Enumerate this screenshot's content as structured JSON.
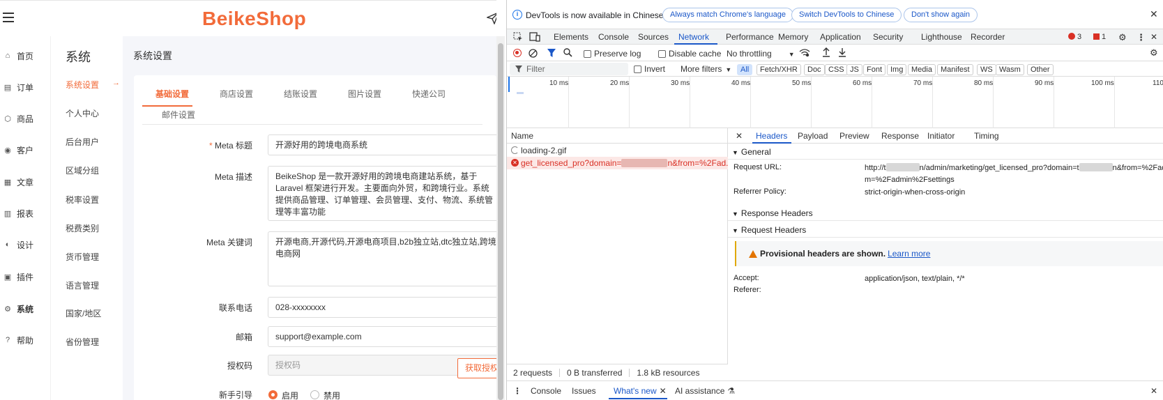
{
  "app": {
    "logo": "BeikeShop",
    "main_nav": [
      {
        "icon": "home-icon",
        "glyph": "⌂",
        "label": "首页"
      },
      {
        "icon": "order-icon",
        "glyph": "▤",
        "label": "订单"
      },
      {
        "icon": "product-icon",
        "glyph": "⬡",
        "label": "商品"
      },
      {
        "icon": "customer-icon",
        "glyph": "◉",
        "label": "客户"
      },
      {
        "icon": "article-icon",
        "glyph": "▦",
        "label": "文章"
      },
      {
        "icon": "report-icon",
        "glyph": "▥",
        "label": "报表"
      },
      {
        "icon": "design-icon",
        "glyph": "◐",
        "label": "设计"
      },
      {
        "icon": "plugin-icon",
        "glyph": "▣",
        "label": "插件"
      },
      {
        "icon": "system-icon",
        "glyph": "⚙",
        "label": "系统"
      },
      {
        "icon": "help-icon",
        "glyph": "?",
        "label": "帮助"
      }
    ],
    "sub_nav_title": "系统",
    "sub_nav": [
      "系统设置",
      "个人中心",
      "后台用户",
      "区域分组",
      "税率设置",
      "税费类别",
      "货币管理",
      "语言管理",
      "国家/地区",
      "省份管理"
    ],
    "page_title": "系统设置",
    "tabs": [
      "基础设置",
      "商店设置",
      "结账设置",
      "图片设置",
      "快递公司",
      "邮件设置"
    ],
    "form": {
      "meta_title_label": "Meta 标题",
      "meta_title_value": "开源好用的跨境电商系统",
      "meta_desc_label": "Meta 描述",
      "meta_desc_value": "BeikeShop 是一款开源好用的跨境电商建站系统，基于 Laravel 框架进行开发。主要面向外贸，和跨境行业。系统提供商品管理、订单管理、会员管理、支付、物流、系统管理等丰富功能",
      "meta_keywords_label": "Meta 关键词",
      "meta_keywords_value": "开源电商,开源代码,开源电商项目,b2b独立站,dtc独立站,跨境电商网",
      "phone_label": "联系电话",
      "phone_value": "028-xxxxxxxx",
      "email_label": "邮箱",
      "email_value": "support@example.com",
      "license_label": "授权码",
      "license_placeholder": "授权码",
      "license_button": "获取授权",
      "guide_label": "新手引导",
      "guide_on": "启用",
      "guide_off": "禁用"
    }
  },
  "devtools": {
    "info_text": "DevTools is now available in Chinese!",
    "info_buttons": [
      "Always match Chrome's language",
      "Switch DevTools to Chinese",
      "Don't show again"
    ],
    "tabs": [
      "Elements",
      "Console",
      "Sources",
      "Network",
      "Performance",
      "Memory",
      "Application",
      "Security",
      "Lighthouse",
      "Recorder"
    ],
    "error_count": "3",
    "issue_count": "1",
    "toolbar": {
      "preserve_log": "Preserve log",
      "disable_cache": "Disable cache",
      "throttling": "No throttling"
    },
    "filter_placeholder": "Filter",
    "invert": "Invert",
    "more_filters": "More filters",
    "type_filters": [
      "All",
      "Fetch/XHR",
      "Doc",
      "CSS",
      "JS",
      "Font",
      "Img",
      "Media",
      "Manifest",
      "WS",
      "Wasm",
      "Other"
    ],
    "timeline_labels": [
      "10 ms",
      "20 ms",
      "30 ms",
      "40 ms",
      "50 ms",
      "60 ms",
      "70 ms",
      "80 ms",
      "90 ms",
      "100 ms",
      "110"
    ],
    "list_header": "Name",
    "requests": [
      {
        "name": "loading-2.gif",
        "status": "pending"
      },
      {
        "name_prefix": "get_licensed_pro?domain=",
        "name_suffix": "n&from=%2Fad...",
        "status": "error"
      }
    ],
    "status_bar": {
      "requests": "2 requests",
      "transferred": "0 B transferred",
      "resources": "1.8 kB resources"
    },
    "detail_tabs": [
      "Headers",
      "Payload",
      "Preview",
      "Response",
      "Initiator",
      "Timing"
    ],
    "general_title": "General",
    "request_url_label": "Request URL:",
    "request_url_value_1a": "http://t",
    "request_url_value_1b": "n/admin/marketing/get_licensed_pro?domain=t",
    "request_url_value_1c": "n&from=%2Fad",
    "request_url_value_2": "m=%2Fadmin%2Fsettings",
    "referrer_policy_label": "Referrer Policy:",
    "referrer_policy_value": "strict-origin-when-cross-origin",
    "response_headers_title": "Response Headers",
    "request_headers_title": "Request Headers",
    "provisional_text": "Provisional headers are shown.",
    "learn_more": "Learn more",
    "accept_label": "Accept:",
    "accept_value": "application/json, text/plain, */*",
    "referer_label": "Referer:",
    "drawer": {
      "console": "Console",
      "issues": "Issues",
      "whats_new": "What's new",
      "ai": "AI assistance"
    }
  }
}
